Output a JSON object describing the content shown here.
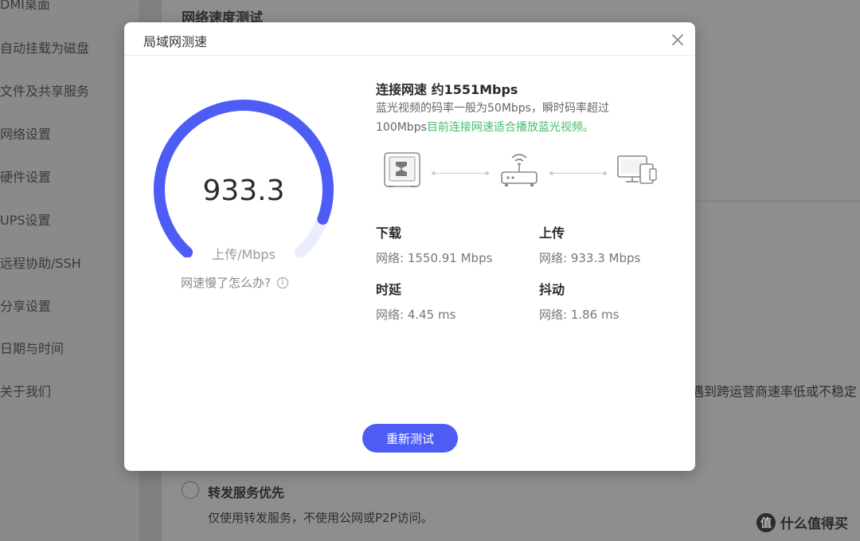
{
  "background": {
    "sidebar_items": [
      "DMI桌面",
      "自动挂载为磁盘",
      "文件及共享服务",
      "网络设置",
      "硬件设置",
      "UPS设置",
      "远程协助/SSH",
      "分享设置",
      "日期与时间",
      "关于我们"
    ],
    "section_title": "网络速度测试",
    "side_note": "遇到跨运营商速率低或不稳定",
    "radio_label": "转发服务优先",
    "radio_desc": "仅使用转发服务，不使用公网或P2P访问。",
    "watermark": "什么值得买",
    "watermark_logo": "值"
  },
  "modal": {
    "title": "局域网测速",
    "gauge": {
      "value": "933.3",
      "unit": "上传/Mbps",
      "fill_fraction": 0.9,
      "color": "#4c5cf5",
      "track_color": "#e9edfd"
    },
    "help_text": "网速慢了怎么办?",
    "connection": {
      "title": "连接网速 约1551Mbps",
      "desc_part1": "蓝光视频的码率一般为50Mbps，瞬时码率超过100Mbps",
      "desc_part2": "目前连接网速适合播放蓝光视频。",
      "green_color": "#3fbf6a"
    },
    "stats": {
      "download_label": "下载",
      "download_value": "网络: 1550.91 Mbps",
      "upload_label": "上传",
      "upload_value": "网络: 933.3 Mbps",
      "latency_label": "时延",
      "latency_value": "网络: 4.45 ms",
      "jitter_label": "抖动",
      "jitter_value": "网络: 1.86 ms"
    },
    "retest_label": "重新测试"
  }
}
